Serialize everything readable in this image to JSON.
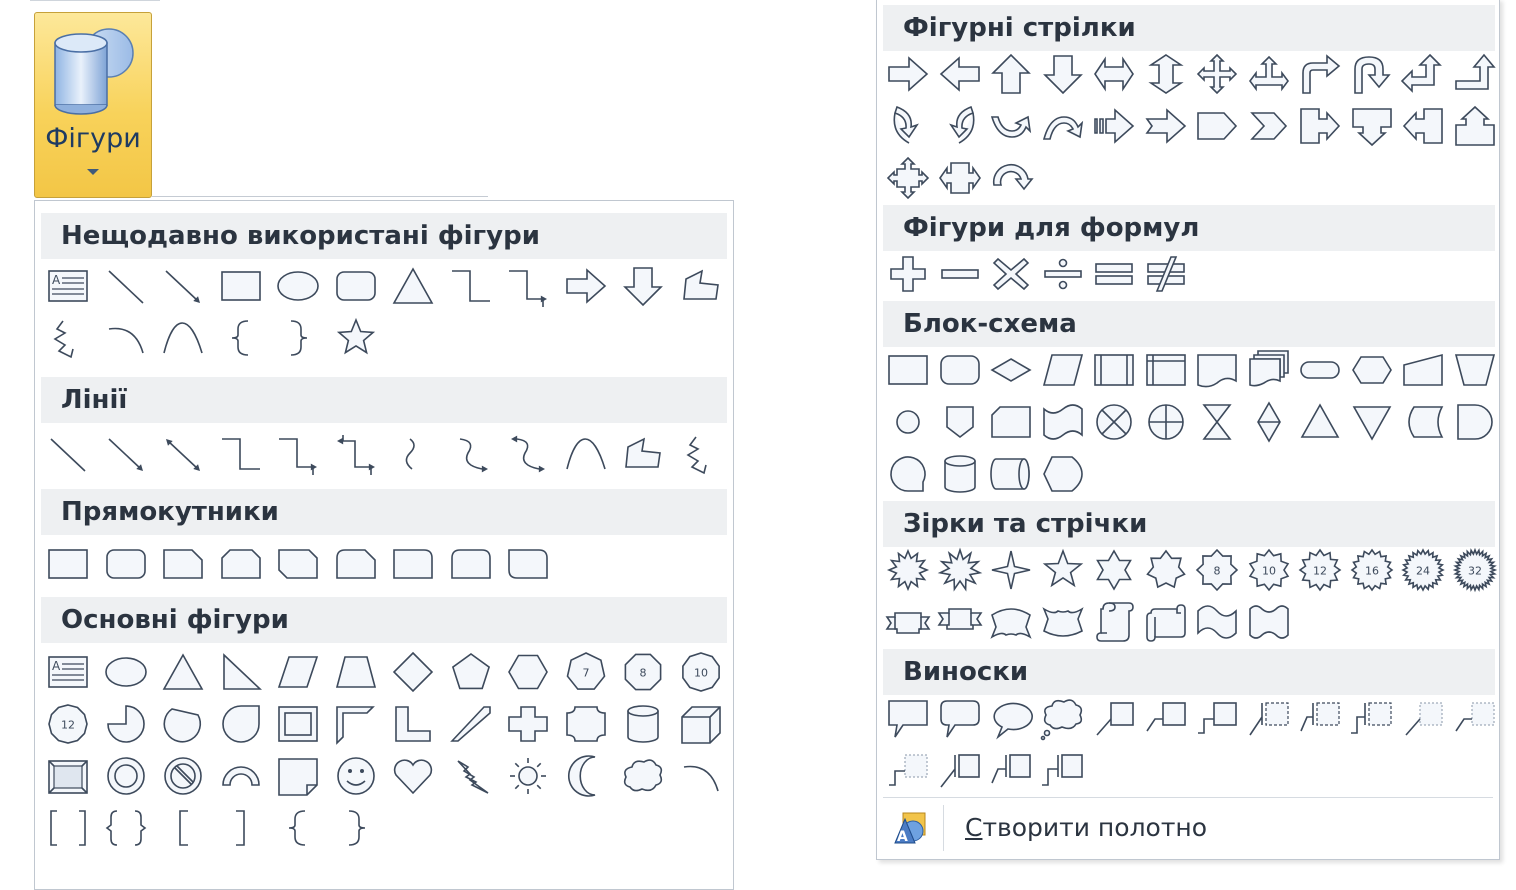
{
  "ribbon": {
    "shapes_button_label": "Фігури"
  },
  "left_panel": {
    "sections": [
      {
        "title": "Нещодавно використані фігури",
        "rows": [
          [
            "textbox",
            "line",
            "arrow",
            "rect",
            "oval",
            "roundrect",
            "triangle",
            "elbow",
            "elbow-arrow",
            "right-arrow",
            "down-arrow",
            "freeform"
          ],
          [
            "scribble",
            "arc",
            "curve",
            "left-brace",
            "right-brace",
            "star"
          ]
        ]
      },
      {
        "title": "Лінії",
        "rows": [
          [
            "line",
            "arrow",
            "double-arrow",
            "elbow",
            "elbow-arrow",
            "elbow-double-arrow",
            "curve-connector",
            "curve-arrow",
            "curve-double-arrow",
            "curve",
            "freeform",
            "scribble"
          ]
        ]
      },
      {
        "title": "Прямокутники",
        "rows": [
          [
            "rect",
            "roundrect",
            "snip-one",
            "snip-same",
            "snip-diag",
            "snip-round",
            "round-one",
            "round-same",
            "round-diag"
          ]
        ]
      },
      {
        "title": "Основні фігури",
        "rows": [
          [
            "textbox",
            "oval",
            "triangle",
            "right-triangle",
            "parallelogram",
            "trapezoid",
            "diamond",
            "pentagon",
            "hexagon",
            "heptagon",
            "octagon",
            "decagon"
          ],
          [
            "dodecagon",
            "pie",
            "chord",
            "teardrop",
            "frame",
            "half-frame",
            "l-shape",
            "diagonal-stripe",
            "plus",
            "plaque",
            "can",
            "cube"
          ],
          [
            "bevel",
            "donut",
            "no-symbol",
            "block-arc",
            "folded-corner",
            "smiley",
            "heart",
            "lightning",
            "sun",
            "moon",
            "cloud",
            "arc"
          ],
          [
            "double-bracket",
            "double-brace",
            "left-bracket",
            "right-bracket",
            "left-brace",
            "right-brace"
          ]
        ]
      }
    ]
  },
  "right_panel": {
    "sections": [
      {
        "title": "Фігурні стрілки",
        "rows": [
          [
            "right-arrow",
            "left-arrow",
            "up-arrow",
            "down-arrow",
            "left-right-arrow",
            "up-down-arrow",
            "quad-arrow",
            "left-right-up-arrow",
            "bent-arrow",
            "u-turn-arrow",
            "left-up-arrow",
            "bent-up-arrow"
          ],
          [
            "curved-right-arrow",
            "curved-left-arrow",
            "curved-up-arrow",
            "curved-down-arrow",
            "striped-right-arrow",
            "notched-right-arrow",
            "pentagon-arrow",
            "chevron",
            "right-arrow-callout",
            "down-arrow-callout",
            "left-arrow-callout",
            "up-arrow-callout"
          ],
          [
            "quad-arrow-callout",
            "left-right-arrow-callout",
            "circular-arrow"
          ]
        ]
      },
      {
        "title": "Фігури для формул",
        "rows": [
          [
            "plus-sign",
            "minus-sign",
            "multiply-sign",
            "division-sign",
            "equal-sign",
            "not-equal-sign"
          ]
        ]
      },
      {
        "title": "Блок-схема",
        "rows": [
          [
            "fc-process",
            "fc-alternate",
            "fc-decision",
            "fc-data",
            "fc-predefined",
            "fc-internal",
            "fc-document",
            "fc-multidoc",
            "fc-terminator",
            "fc-preparation",
            "fc-manual-input",
            "fc-manual-op"
          ],
          [
            "fc-connector",
            "fc-offpage",
            "fc-card",
            "fc-punched-tape",
            "fc-summing",
            "fc-or",
            "fc-collate",
            "fc-sort",
            "fc-extract",
            "fc-merge",
            "fc-stored-data",
            "fc-delay"
          ],
          [
            "fc-seq-access",
            "fc-magnetic-disk",
            "fc-direct-access",
            "fc-display"
          ]
        ]
      },
      {
        "title": "Зірки та стрічки",
        "rows": [
          [
            "explosion1",
            "explosion2",
            "star4",
            "star5",
            "star6",
            "star7",
            "star8",
            "star10",
            "star12",
            "star16",
            "star24",
            "star32"
          ],
          [
            "ribbon-up",
            "ribbon-down",
            "curved-ribbon-up",
            "curved-ribbon-down",
            "scroll-vertical",
            "scroll-horizontal",
            "wave",
            "double-wave"
          ]
        ]
      },
      {
        "title": "Виноски",
        "rows": [
          [
            "callout-rect",
            "callout-roundrect",
            "callout-oval",
            "callout-cloud",
            "line-callout1",
            "line-callout2",
            "line-callout3",
            "line-callout1-accent",
            "line-callout2-accent",
            "line-callout3-accent",
            "line-callout1-noborder",
            "line-callout2-noborder"
          ],
          [
            "line-callout3-noborder",
            "line-callout1-bar",
            "line-callout2-bar",
            "line-callout3-bar"
          ]
        ]
      }
    ],
    "footer": {
      "create_canvas_label_prefix": "С",
      "create_canvas_label_rest": "творити полотно"
    }
  },
  "badges": {
    "heptagon": "7",
    "octagon": "8",
    "decagon": "10",
    "dodecagon": "12",
    "star8": "8",
    "star10": "10",
    "star12": "12",
    "star16": "16",
    "star24": "24",
    "star32": "32"
  }
}
